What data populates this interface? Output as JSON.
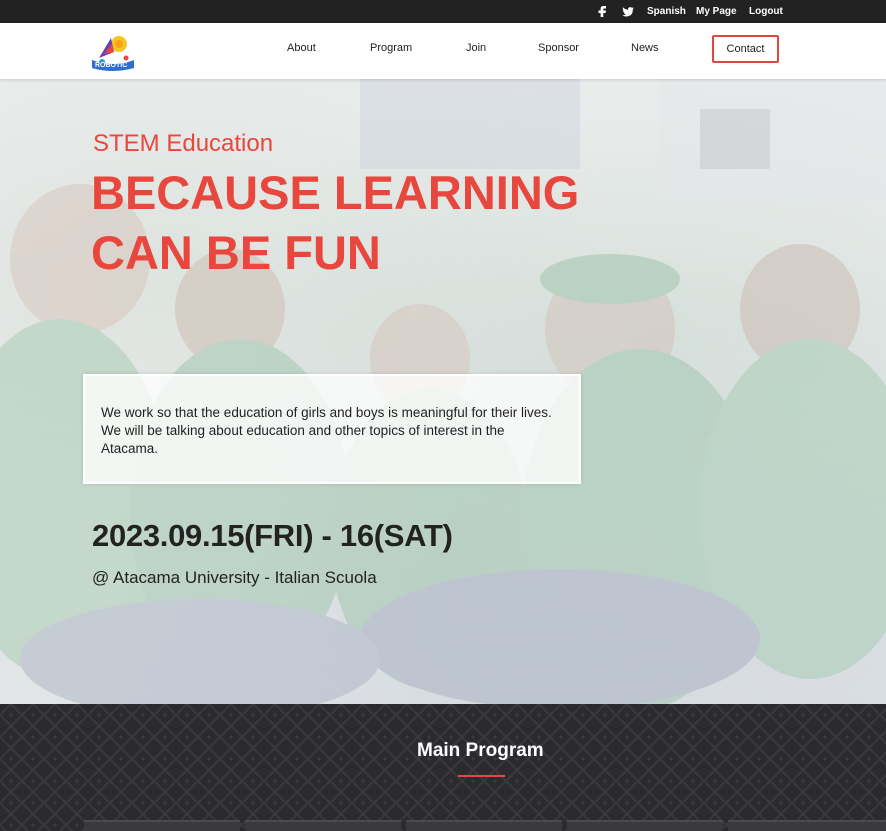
{
  "topbar": {
    "facebook_icon": "facebook-icon",
    "twitter_icon": "twitter-icon",
    "language": "Spanish",
    "my_page": "My Page",
    "logout": "Logout"
  },
  "nav": {
    "logo_icon": "rocket-logo",
    "items": [
      {
        "label": "About"
      },
      {
        "label": "Program"
      },
      {
        "label": "Join"
      },
      {
        "label": "Sponsor"
      },
      {
        "label": "News"
      }
    ],
    "contact_label": "Contact"
  },
  "hero": {
    "subtitle": "STEM Education",
    "title": "BECAUSE LEARNING CAN BE FUN",
    "description": "We work so that the education of girls and boys is meaningful for their lives. We will be talking about education and other topics of interest in the Atacama.",
    "date": "2023.09.15(FRI) - 16(SAT)",
    "venue": "@ Atacama University - Italian Scuola"
  },
  "program": {
    "title": "Main Program"
  },
  "colors": {
    "accent": "#e8473d",
    "topbar_bg": "#222222",
    "program_bg": "#2b2b2f"
  }
}
